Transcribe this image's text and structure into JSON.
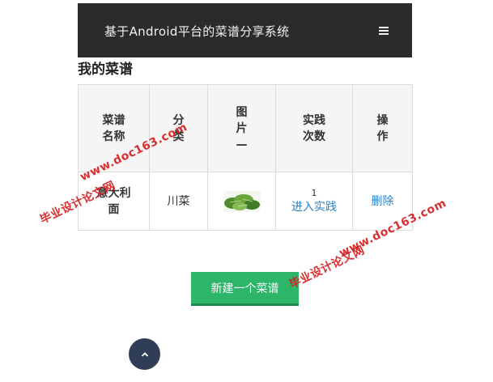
{
  "navbar": {
    "title": "基于Android平台的菜谱分享系统",
    "menu_icon": "hamburger-menu-icon"
  },
  "page_heading": "我的菜谱",
  "table": {
    "headers": [
      "菜谱名称",
      "分类",
      "图片",
      "实践次数",
      "操作"
    ],
    "header_image_suffix": "—",
    "rows": [
      {
        "name": "意大利面",
        "category": "川菜",
        "image": "dish-photo-icon",
        "practice_count": "1",
        "practice_link": "进入实践",
        "action": "删除"
      }
    ]
  },
  "new_button": "新建一个菜谱",
  "back_to_top_icon": "chevron-up-icon",
  "watermarks": {
    "site": "www.doc163.com",
    "label": "毕业设计论文网"
  },
  "colors": {
    "navbar_bg": "#2b2b2b",
    "link": "#2a82c8",
    "primary": "#2db56a",
    "top_button": "#2f3e56"
  }
}
